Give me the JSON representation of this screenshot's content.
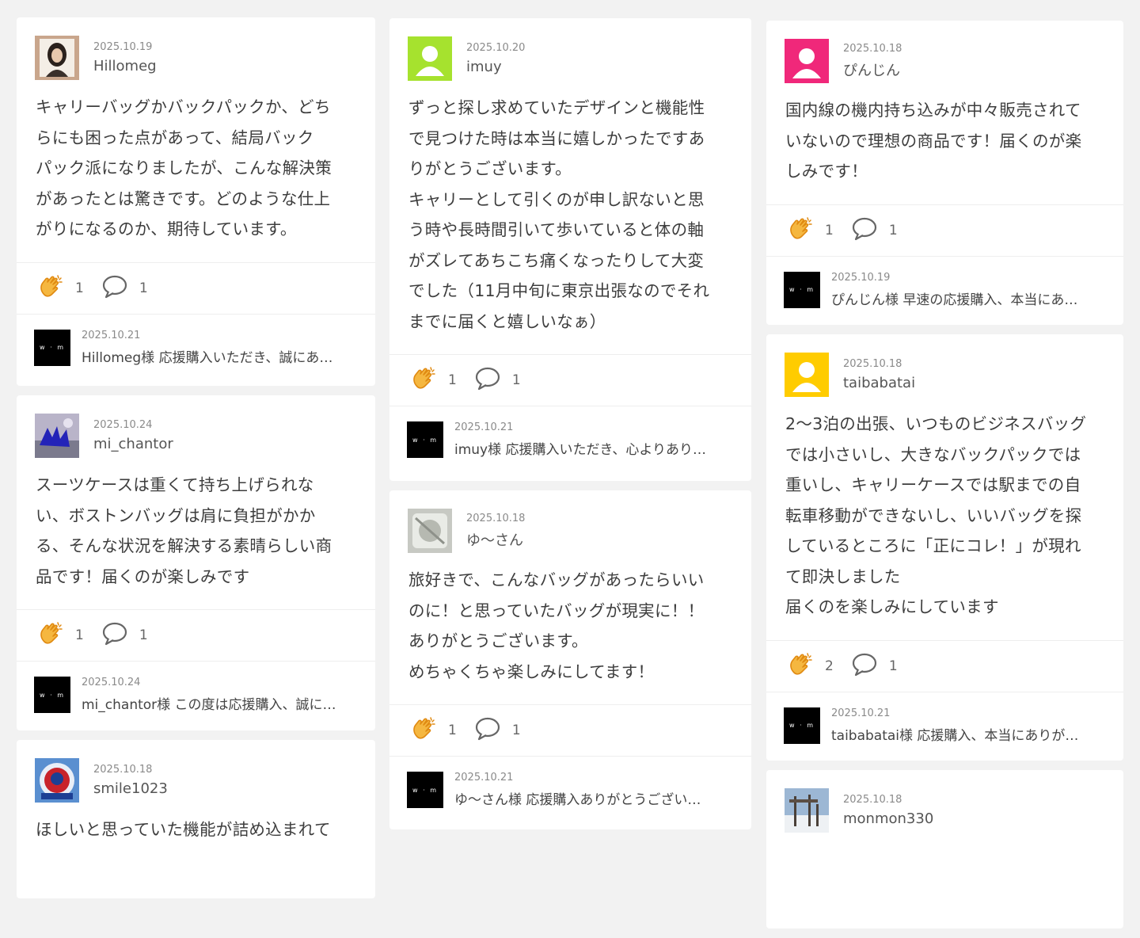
{
  "colors": {
    "page_bg": "#f2f2f2",
    "card_bg": "#ffffff",
    "clap": "#f5a623",
    "avatar_green": "#a6e22e",
    "avatar_pink": "#f0287a",
    "avatar_yellow": "#ffcc00"
  },
  "shop_logo_text": "w · m",
  "columns": [
    [
      {
        "avatar": "photo-woman",
        "date": "2025.10.19",
        "user": "Hillomeg",
        "body": "キャリーバッグかバックパックか、どち\nらにも困った点があって、結局バック\nパック派になりましたが、こんな解決策\nがあったとは驚きです。どのような仕上\nがりになるのか、期待しています。",
        "claps": "1",
        "comments": "1",
        "reply_date": "2025.10.21",
        "reply_text": "Hillomeg様 応援購入いただき、誠にあ…"
      },
      {
        "avatar": "photo-hands",
        "date": "2025.10.24",
        "user": "mi_chantor",
        "body": "スーツケースは重くて持ち上げられな\nい、ボストンバッグは肩に負担がかか\nる、そんな状況を解決する素晴らしい商\n品です！届くのが楽しみです",
        "claps": "1",
        "comments": "1",
        "reply_date": "2025.10.24",
        "reply_text": "mi_chantor様 この度は応援購入、誠に…"
      },
      {
        "avatar": "photo-logo",
        "date": "2025.10.18",
        "user": "smile1023",
        "body": "ほしいと思っていた機能が詰め込まれて",
        "claps": "",
        "comments": "",
        "reply_date": "",
        "reply_text": ""
      }
    ],
    [
      {
        "avatar": "default-green",
        "date": "2025.10.20",
        "user": "imuy",
        "body": "ずっと探し求めていたデザインと機能性\nで見つけた時は本当に嬉しかったですあ\nりがとうございます。\nキャリーとして引くのが申し訳ないと思\nう時や長時間引いて歩いていると体の軸\nがズレてあちこち痛くなったりして大変\nでした（11月中旬に東京出張なのでそれ\nまでに届くと嬉しいなぁ）",
        "claps": "1",
        "comments": "1",
        "reply_date": "2025.10.21",
        "reply_text": "imuy様 応援購入いただき、心よりあり…"
      },
      {
        "avatar": "photo-glass",
        "date": "2025.10.18",
        "user": "ゆ〜さん",
        "body": "旅好きで、こんなバッグがあったらいい\nのに！と思っていたバッグが現実に！！\nありがとうございます。\nめちゃくちゃ楽しみにしてます！",
        "claps": "1",
        "comments": "1",
        "reply_date": "2025.10.21",
        "reply_text": "ゆ〜さん様 応援購入ありがとうござい…"
      }
    ],
    [
      {
        "avatar": "default-pink",
        "date": "2025.10.18",
        "user": "ぴんじん",
        "body": "国内線の機内持ち込みが中々販売されて\nいないので理想の商品です！届くのが楽\nしみです！",
        "claps": "1",
        "comments": "1",
        "reply_date": "2025.10.19",
        "reply_text": "ぴんじん様 早速の応援購入、本当にあ…"
      },
      {
        "avatar": "default-yellow",
        "date": "2025.10.18",
        "user": "taibabatai",
        "body": "2〜3泊の出張、いつものビジネスバッグ\nでは小さいし、大きなバックパックでは\n重いし、キャリーケースでは駅までの自\n転車移動ができないし、いいバッグを探\nしているところに「正にコレ！」が現れ\nて即決しました\n届くのを楽しみにしています",
        "claps": "2",
        "comments": "1",
        "reply_date": "2025.10.21",
        "reply_text": "taibabatai様 応援購入、本当にありが…"
      },
      {
        "avatar": "photo-snow",
        "date": "2025.10.18",
        "user": "monmon330",
        "body": "",
        "claps": "",
        "comments": "",
        "reply_date": "",
        "reply_text": ""
      }
    ]
  ]
}
